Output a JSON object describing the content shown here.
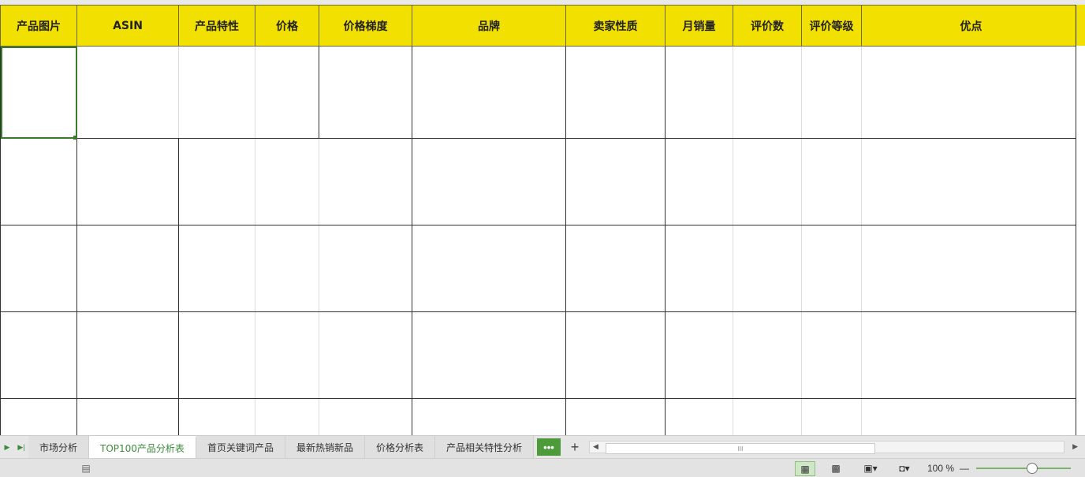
{
  "sheet": {
    "headers": [
      "产品图片",
      "ASIN",
      "产品特性",
      "价格",
      "价格梯度",
      "品牌",
      "卖家性质",
      "月销量",
      "评价数",
      "评价等级",
      "优点"
    ]
  },
  "tabs": {
    "items": [
      "市场分析",
      "TOP100产品分析表",
      "首页关键词产品",
      "最新热销新品",
      "价格分析表",
      "产品相关特性分析"
    ],
    "active_index": 1,
    "more_label": "•••",
    "add_label": "+",
    "scroll_thumb_label": "III"
  },
  "status": {
    "zoom": "100 %",
    "zoom_minus": "—"
  },
  "colors": {
    "header_fill": "#f2e100",
    "accent": "#4c9a3a"
  }
}
